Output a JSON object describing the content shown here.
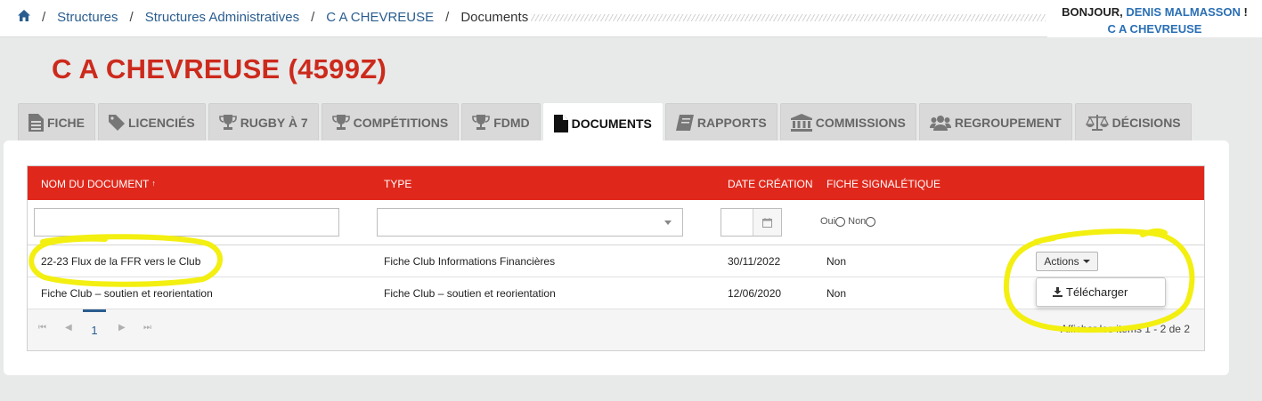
{
  "breadcrumb": {
    "items": [
      "Structures",
      "Structures Administratives",
      "C A CHEVREUSE"
    ],
    "current": "Documents"
  },
  "greeting": {
    "hello": "BONJOUR,",
    "user": "DENIS MALMASSON",
    "suffix": "!",
    "club": "C A CHEVREUSE"
  },
  "page_title": "C A CHEVREUSE (4599Z)",
  "tabs": [
    {
      "label": "FICHE",
      "icon": "document-icon",
      "active": false
    },
    {
      "label": "LICENCIÉS",
      "icon": "tag-icon",
      "active": false
    },
    {
      "label": "RUGBY À 7",
      "icon": "trophy-icon",
      "active": false
    },
    {
      "label": "COMPÉTITIONS",
      "icon": "trophy-icon",
      "active": false
    },
    {
      "label": "FDMD",
      "icon": "trophy-icon",
      "active": false
    },
    {
      "label": "DOCUMENTS",
      "icon": "file-icon",
      "active": true
    },
    {
      "label": "RAPPORTS",
      "icon": "book-icon",
      "active": false
    },
    {
      "label": "COMMISSIONS",
      "icon": "institution-icon",
      "active": false
    },
    {
      "label": "REGROUPEMENT",
      "icon": "users-icon",
      "active": false
    },
    {
      "label": "DÉCISIONS",
      "icon": "balance-icon",
      "active": false
    }
  ],
  "grid": {
    "columns": {
      "name": "NOM DU DOCUMENT",
      "name_sort": "↑",
      "type": "TYPE",
      "date": "DATE CRÉATION",
      "fiche": "FICHE SIGNALÉTIQUE"
    },
    "filters": {
      "name_value": "",
      "type_value": "",
      "date_value": "",
      "radio_oui": "Oui",
      "radio_non": "Non"
    },
    "rows": [
      {
        "name": "22-23 Flux de la FFR vers le Club",
        "type": "Fiche Club Informations Financières",
        "date": "30/11/2022",
        "fiche": "Non",
        "actions": "Actions"
      },
      {
        "name": "Fiche Club – soutien et reorientation",
        "type": "Fiche Club – soutien et reorientation",
        "date": "12/06/2020",
        "fiche": "Non"
      }
    ],
    "dropdown": {
      "download": "Télécharger"
    },
    "pager": {
      "first": "⏮",
      "prev": "◀",
      "page": "1",
      "next": "▶",
      "last": "⏭",
      "info": "Afficher les items 1 - 2 de 2"
    }
  },
  "colors": {
    "brand_red": "#cc2a1c",
    "header_red": "#e0271b",
    "link_blue": "#2a5d8f",
    "highlight_yellow": "#f3ef10"
  }
}
